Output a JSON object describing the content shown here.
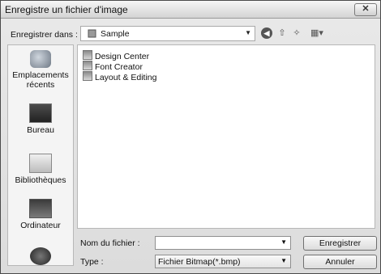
{
  "window": {
    "title": "Enregistre un fichier d'image",
    "close_label": "✕"
  },
  "lookin": {
    "label": "Enregistrer dans :",
    "value": "Sample"
  },
  "toolbar": {
    "back_icon": "back-icon",
    "up_icon": "up-folder-icon",
    "new_folder_icon": "new-folder-icon",
    "views_icon": "views-menu-icon"
  },
  "places": [
    {
      "label": "Emplacements récents",
      "icon": "recent-places-icon"
    },
    {
      "label": "Bureau",
      "icon": "desktop-icon"
    },
    {
      "label": "Bibliothèques",
      "icon": "libraries-icon"
    },
    {
      "label": "Ordinateur",
      "icon": "computer-icon"
    },
    {
      "label": "",
      "icon": "network-icon"
    }
  ],
  "files": [
    {
      "name": "Design Center",
      "icon": "folder-icon"
    },
    {
      "name": "Font Creator",
      "icon": "folder-icon"
    },
    {
      "name": "Layout & Editing",
      "icon": "folder-icon"
    }
  ],
  "filename": {
    "label": "Nom du fichier :",
    "value": ""
  },
  "filetype": {
    "label": "Type :",
    "value": "Fichier Bitmap(*.bmp)"
  },
  "buttons": {
    "save": "Enregistrer",
    "cancel": "Annuler"
  }
}
